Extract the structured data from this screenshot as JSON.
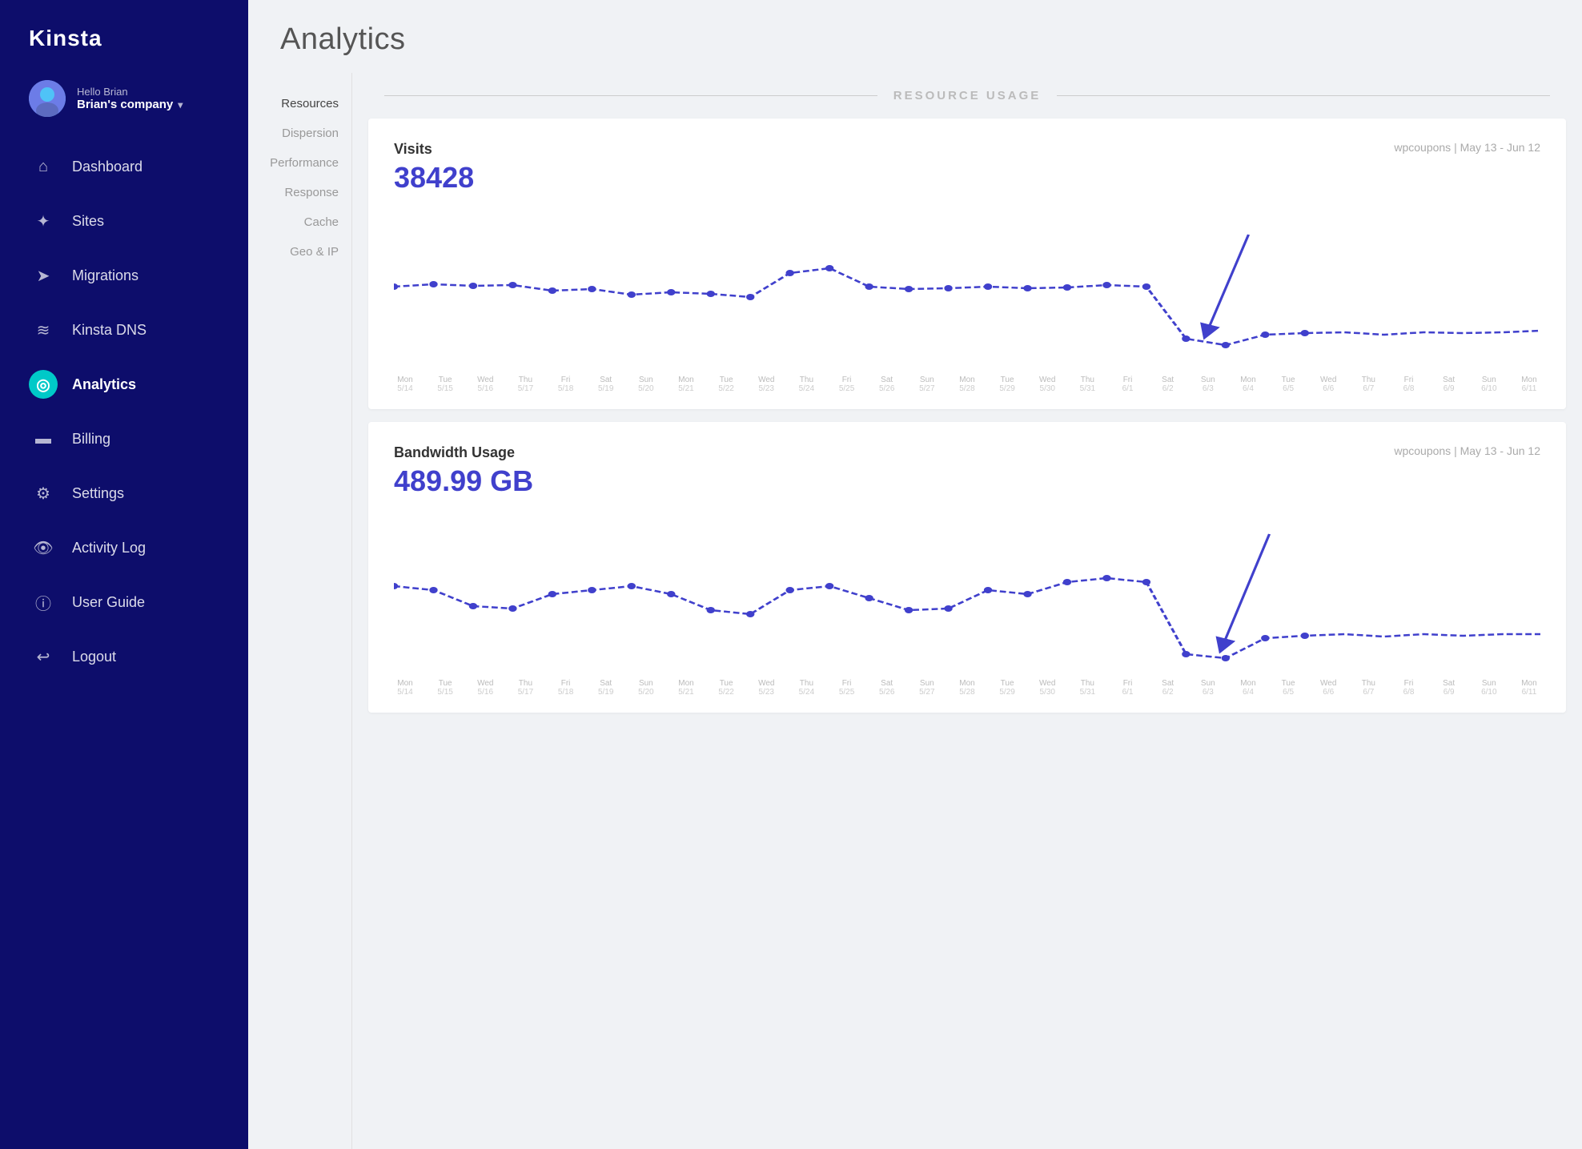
{
  "sidebar": {
    "logo": "Kinsta",
    "user": {
      "hello": "Hello Brian",
      "company": "Brian's company",
      "chevron": "▾"
    },
    "nav_items": [
      {
        "id": "dashboard",
        "label": "Dashboard",
        "icon": "⌂",
        "active": false
      },
      {
        "id": "sites",
        "label": "Sites",
        "icon": "✦",
        "active": false
      },
      {
        "id": "migrations",
        "label": "Migrations",
        "icon": "➤",
        "active": false
      },
      {
        "id": "kinsta-dns",
        "label": "Kinsta DNS",
        "icon": "≋",
        "active": false
      },
      {
        "id": "analytics",
        "label": "Analytics",
        "icon": "◎",
        "active": true
      },
      {
        "id": "billing",
        "label": "Billing",
        "icon": "▬",
        "active": false
      },
      {
        "id": "settings",
        "label": "Settings",
        "icon": "⚙",
        "active": false
      },
      {
        "id": "activity-log",
        "label": "Activity Log",
        "icon": "👁",
        "active": false
      },
      {
        "id": "user-guide",
        "label": "User Guide",
        "icon": "ⓘ",
        "active": false
      },
      {
        "id": "logout",
        "label": "Logout",
        "icon": "↩",
        "active": false
      }
    ]
  },
  "page": {
    "title": "Analytics"
  },
  "sub_nav": {
    "items": [
      {
        "id": "resources",
        "label": "Resources",
        "active": true
      },
      {
        "id": "dispersion",
        "label": "Dispersion",
        "active": false
      },
      {
        "id": "performance",
        "label": "Performance",
        "active": false
      },
      {
        "id": "response",
        "label": "Response",
        "active": false
      },
      {
        "id": "cache",
        "label": "Cache",
        "active": false
      },
      {
        "id": "geo-ip",
        "label": "Geo & IP",
        "active": false
      }
    ]
  },
  "resource_usage": {
    "header": "RESOURCE USAGE",
    "charts": [
      {
        "id": "visits",
        "title": "Visits",
        "value": "38428",
        "meta": "wpcoupons | May 13 - Jun 12",
        "color": "#4040cc"
      },
      {
        "id": "bandwidth",
        "title": "Bandwidth Usage",
        "value": "489.99 GB",
        "meta": "wpcoupons | May 13 - Jun 12",
        "color": "#4040cc"
      }
    ]
  },
  "x_axis_labels": [
    {
      "day": "Mon",
      "date": "5/14"
    },
    {
      "day": "Tue",
      "date": "5/15"
    },
    {
      "day": "Wed",
      "date": "5/16"
    },
    {
      "day": "Thu",
      "date": "5/17"
    },
    {
      "day": "Fri",
      "date": "5/18"
    },
    {
      "day": "Sat",
      "date": "5/19"
    },
    {
      "day": "Sun",
      "date": "5/20"
    },
    {
      "day": "Mon",
      "date": "5/21"
    },
    {
      "day": "Tue",
      "date": "5/22"
    },
    {
      "day": "Wed",
      "date": "5/23"
    },
    {
      "day": "Thu",
      "date": "5/24"
    },
    {
      "day": "Fri",
      "date": "5/25"
    },
    {
      "day": "Sat",
      "date": "5/26"
    },
    {
      "day": "Sun",
      "date": "5/27"
    },
    {
      "day": "Mon",
      "date": "5/28"
    },
    {
      "day": "Tue",
      "date": "5/29"
    },
    {
      "day": "Wed",
      "date": "5/30"
    },
    {
      "day": "Thu",
      "date": "5/31"
    },
    {
      "day": "Fri",
      "date": "6/1"
    },
    {
      "day": "Sat",
      "date": "6/2"
    },
    {
      "day": "Sun",
      "date": "6/3"
    },
    {
      "day": "Mon",
      "date": "6/4"
    },
    {
      "day": "Tue",
      "date": "6/5"
    },
    {
      "day": "Wed",
      "date": "6/6"
    },
    {
      "day": "Thu",
      "date": "6/7"
    },
    {
      "day": "Fri",
      "date": "6/8"
    },
    {
      "day": "Sat",
      "date": "6/9"
    },
    {
      "day": "Sun",
      "date": "6/10"
    },
    {
      "day": "Mon",
      "date": "6/11"
    }
  ]
}
